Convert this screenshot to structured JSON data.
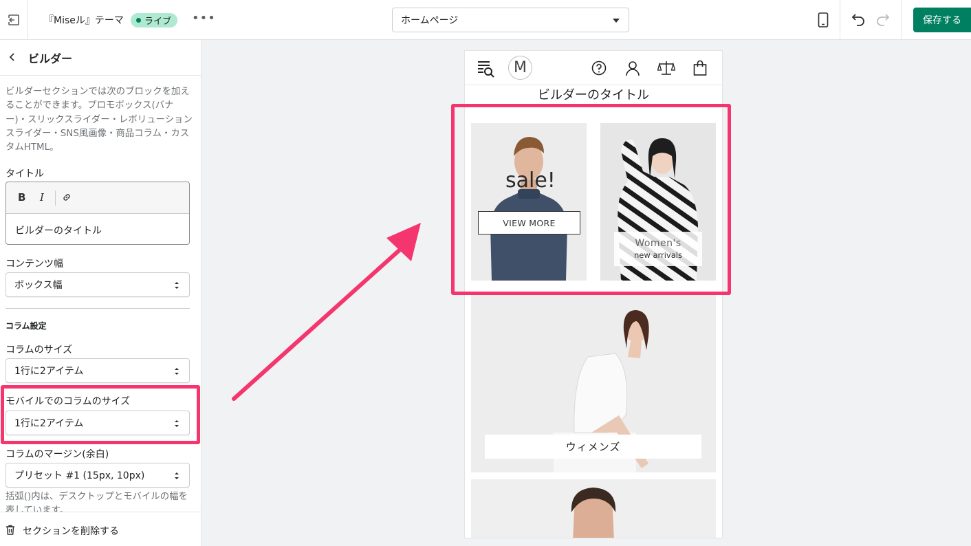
{
  "topbar": {
    "theme_name": "『Miseル』テーマ",
    "live_badge": "ライブ",
    "more": "•••",
    "page_select": "ホームページ",
    "save_label": "保存する"
  },
  "sidebar": {
    "title": "ビルダー",
    "description": "ビルダーセクションでは次のブロックを加えることができます。プロモボックス(バナー)・スリックスライダー・レボリューションスライダー・SNS風画像・商品コラム・カスタムHTML。",
    "title_label": "タイトル",
    "rte_bold": "B",
    "rte_italic": "I",
    "rte_value": "ビルダーのタイトル",
    "content_width_label": "コンテンツ幅",
    "content_width_value": "ボックス幅",
    "column_settings_heading": "コラム設定",
    "column_size_label": "コラムのサイズ",
    "column_size_value": "1行に2アイテム",
    "mobile_column_size_label": "モバイルでのコラムのサイズ",
    "mobile_column_size_value": "1行に2アイテム",
    "column_margin_label": "コラムのマージン(余白)",
    "column_margin_value": "プリセット #1 (15px, 10px)",
    "help_text": "括弧()内は、デスクトップとモバイルの幅を表しています。",
    "delete_label": "セクションを削除する"
  },
  "preview": {
    "logo": "M",
    "section_title": "ビルダーのタイトル",
    "tile1_overlay_text": "sale!",
    "tile1_button": "VIEW MORE",
    "tile2_title": "Women's",
    "tile2_subtitle": "new arrivals",
    "tile3_label": "ウィメンズ"
  },
  "colors": {
    "accent_green": "#008060",
    "live_badge_bg": "#aee9d1",
    "highlight_pink": "#f4356e"
  },
  "icons": [
    "exit-icon",
    "more-icon",
    "mobile-device-icon",
    "undo-icon",
    "redo-icon",
    "back-icon",
    "link-icon",
    "select-arrows-icon",
    "trash-icon",
    "menu-search-icon",
    "help-icon",
    "account-icon",
    "compare-icon",
    "cart-bag-icon",
    "annotation-arrow-icon"
  ]
}
